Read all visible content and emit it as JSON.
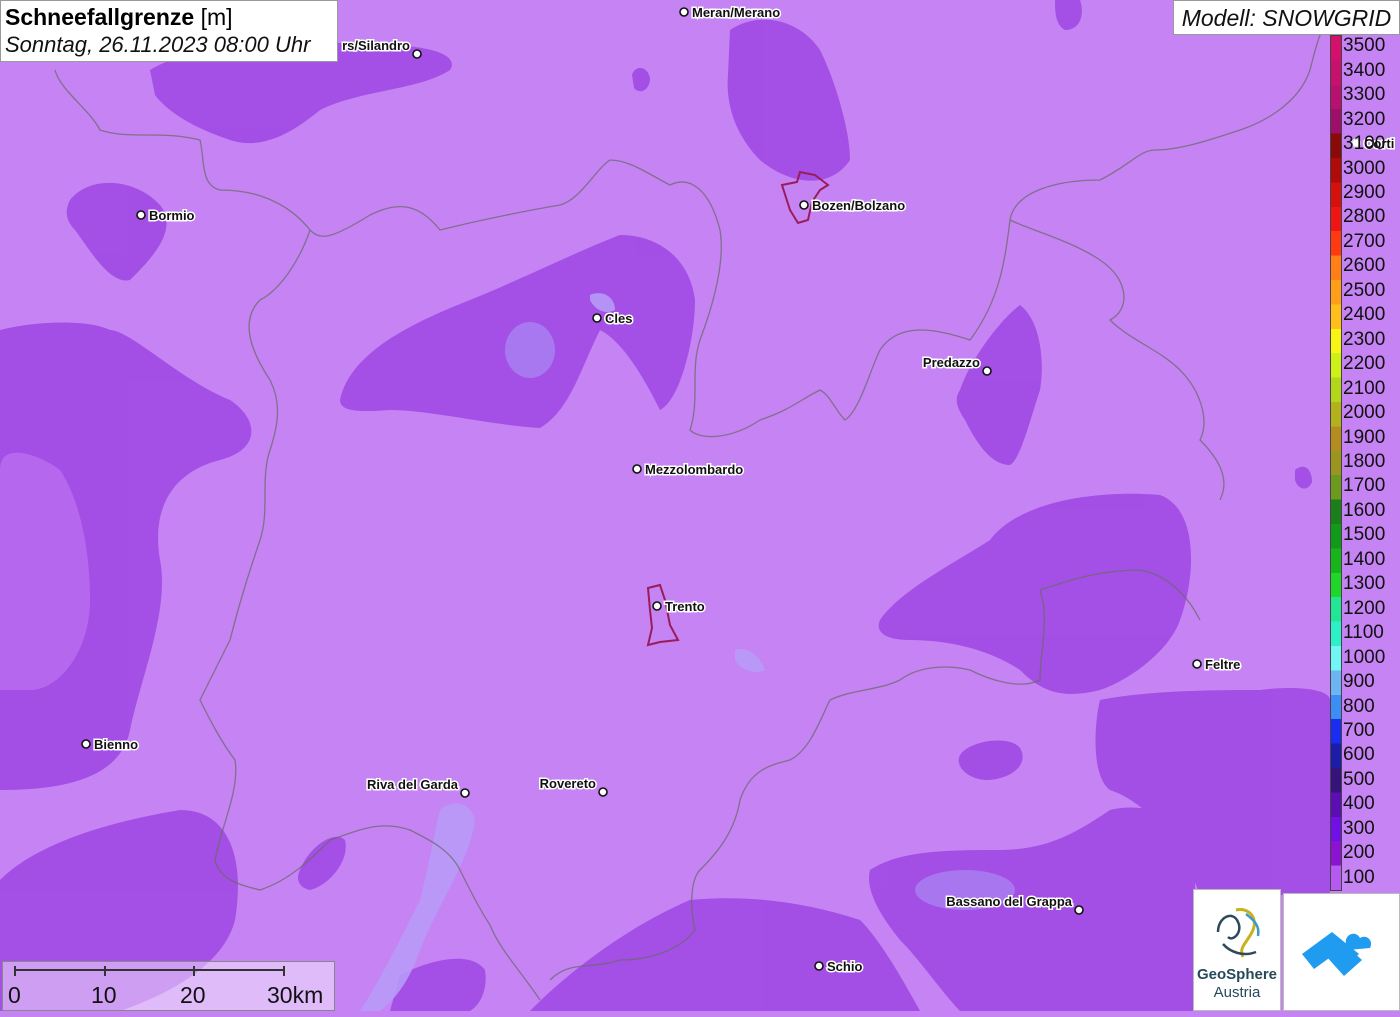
{
  "title": {
    "main": "Schneefallgrenze",
    "unit": " [m]",
    "datetime": "Sonntag, 26.11.2023 08:00 Uhr"
  },
  "model": "Modell: SNOWGRID",
  "legend": [
    {
      "label": "3500",
      "color": "#d4106c"
    },
    {
      "label": "3400",
      "color": "#c8106e"
    },
    {
      "label": "3300",
      "color": "#b81070"
    },
    {
      "label": "3200",
      "color": "#9e0f6c"
    },
    {
      "label": "3100",
      "color": "#8a0a0a"
    },
    {
      "label": "3000",
      "color": "#b00a0a"
    },
    {
      "label": "2900",
      "color": "#d60f0f"
    },
    {
      "label": "2800",
      "color": "#ee1515"
    },
    {
      "label": "2700",
      "color": "#ff3a10"
    },
    {
      "label": "2600",
      "color": "#ff7f16"
    },
    {
      "label": "2500",
      "color": "#ff9e18"
    },
    {
      "label": "2400",
      "color": "#ffbe19"
    },
    {
      "label": "2300",
      "color": "#f8f515"
    },
    {
      "label": "2200",
      "color": "#ccf018"
    },
    {
      "label": "2100",
      "color": "#b4d61a"
    },
    {
      "label": "2000",
      "color": "#b3b21d"
    },
    {
      "label": "1900",
      "color": "#b38d20"
    },
    {
      "label": "1800",
      "color": "#9a9420"
    },
    {
      "label": "1700",
      "color": "#6d9a1e"
    },
    {
      "label": "1600",
      "color": "#1a7e1a"
    },
    {
      "label": "1500",
      "color": "#119a1a"
    },
    {
      "label": "1400",
      "color": "#17b41c"
    },
    {
      "label": "1300",
      "color": "#20d628"
    },
    {
      "label": "1200",
      "color": "#22e696"
    },
    {
      "label": "1100",
      "color": "#2ef0c8"
    },
    {
      "label": "1000",
      "color": "#72f5f5"
    },
    {
      "label": "900",
      "color": "#6eb4f5"
    },
    {
      "label": "800",
      "color": "#3c8ef5"
    },
    {
      "label": "700",
      "color": "#1a2cf0"
    },
    {
      "label": "600",
      "color": "#1c1ca8"
    },
    {
      "label": "500",
      "color": "#36137a"
    },
    {
      "label": "400",
      "color": "#5c0db4"
    },
    {
      "label": "300",
      "color": "#7010e6"
    },
    {
      "label": "200",
      "color": "#8c12d2"
    },
    {
      "label": "100",
      "color": "#b45af0"
    }
  ],
  "cities": [
    {
      "name": "Meran/Merano"
    },
    {
      "name": "rs/Silandro"
    },
    {
      "name": "Bormio"
    },
    {
      "name": "Bozen/Bolzano"
    },
    {
      "name": "Cles"
    },
    {
      "name": "Predazzo"
    },
    {
      "name": "Mezzolombardo"
    },
    {
      "name": "Trento"
    },
    {
      "name": "Feltre"
    },
    {
      "name": "Bienno"
    },
    {
      "name": "Riva del Garda"
    },
    {
      "name": "Rovereto"
    },
    {
      "name": "Bassano del Grappa"
    },
    {
      "name": "Schio"
    },
    {
      "name": "Corti"
    }
  ],
  "scalebar": {
    "labels": [
      "0",
      "10",
      "20",
      "30km"
    ]
  },
  "logo": {
    "line1": "GeoSphere",
    "line2": "Austria"
  },
  "colors": {
    "base": "#c583f4",
    "dark": "#9a3fe0",
    "mid": "#a24ce4",
    "blue": "#a27ef0",
    "border": "#6a6a6a",
    "app_logo": "#1f9cf0"
  }
}
